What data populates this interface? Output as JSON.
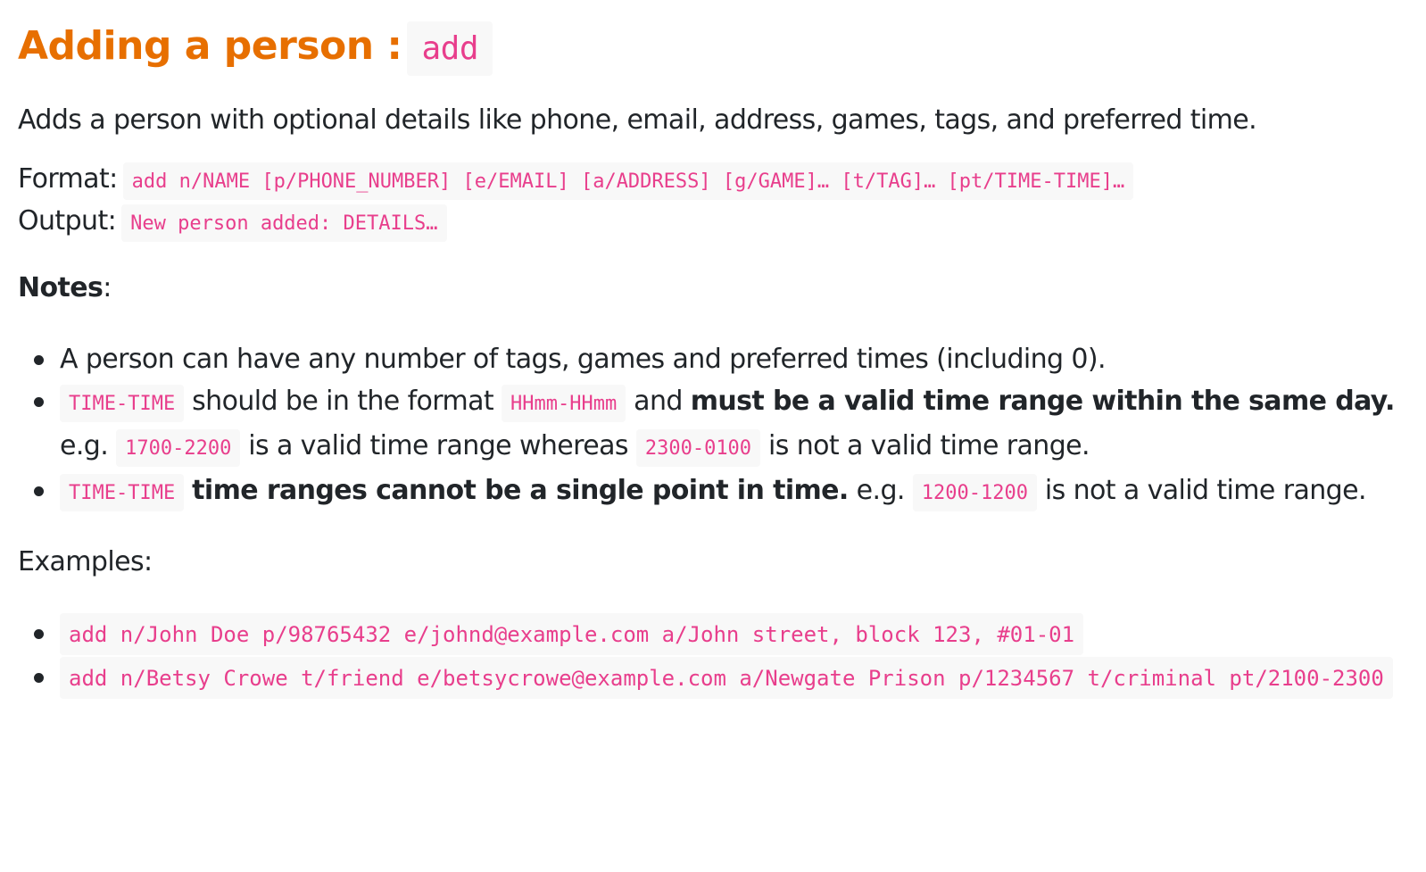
{
  "heading": {
    "title": "Adding a person :",
    "command": "add"
  },
  "description": "Adds a person with optional details like phone, email, address, games, tags, and preferred time.",
  "format": {
    "label": "Format:",
    "value": "add n/NAME [p/PHONE_NUMBER] [e/EMAIL] [a/ADDRESS] [g/GAME]… [t/TAG]… [pt/TIME-TIME]…"
  },
  "output": {
    "label": "Output:",
    "value": "New person added: DETAILS…"
  },
  "notes": {
    "label": "Notes",
    "colon": ":",
    "item1": "A person can have any number of tags, games and preferred times (including 0).",
    "item2": {
      "code1": "TIME-TIME",
      "text1": " should be in the format ",
      "code2": "HHmm-HHmm",
      "text2": " and ",
      "bold": "must be a valid time range within the same day.",
      "eg_prefix": "e.g. ",
      "code3": "1700-2200",
      "text3": " is a valid time range whereas ",
      "code4": "2300-0100",
      "text4": " is not a valid time range."
    },
    "item3": {
      "code1": "TIME-TIME",
      "bold": "time ranges cannot be a single point in time.",
      "eg_prefix": " e.g. ",
      "code2": "1200-1200",
      "text1": " is not a valid time range."
    }
  },
  "examples": {
    "label": "Examples:",
    "items": [
      "add n/John Doe p/98765432 e/johnd@example.com a/John street, block 123, #01-01",
      "add n/Betsy Crowe t/friend e/betsycrowe@example.com a/Newgate Prison p/1234567 t/criminal pt/2100-2300"
    ]
  },
  "colors": {
    "heading": "#e76f00",
    "code_text": "#e83e8c",
    "code_bg": "#f8f8f8",
    "body_text": "#212529"
  }
}
